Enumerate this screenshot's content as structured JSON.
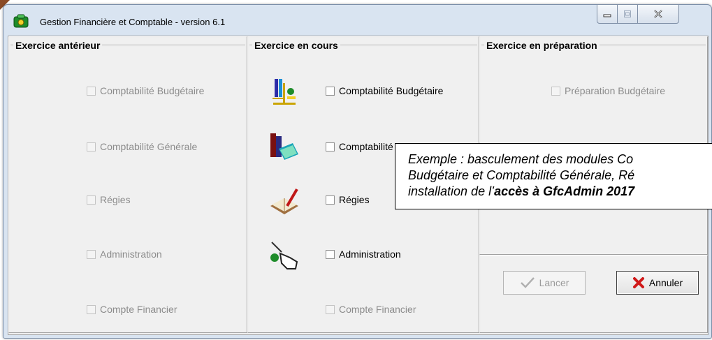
{
  "window": {
    "title": "Gestion Financière et Comptable - version 6.1",
    "controls": [
      "minimize-icon",
      "maximize-icon",
      "close-icon"
    ]
  },
  "panels": {
    "anterieur": {
      "title": "Exercice antérieur",
      "items": [
        {
          "label": "Comptabilité Budgétaire",
          "checked": false,
          "enabled": false
        },
        {
          "label": "Comptabilité Générale",
          "checked": false,
          "enabled": false
        },
        {
          "label": "Régies",
          "checked": false,
          "enabled": false
        },
        {
          "label": "Administration",
          "checked": false,
          "enabled": false
        },
        {
          "label": "Compte Financier",
          "checked": false,
          "enabled": false
        }
      ]
    },
    "en_cours": {
      "title": "Exercice en cours",
      "items": [
        {
          "label": "Comptabilité Budgétaire",
          "icon": "budget-scale-icon",
          "checked": false,
          "enabled": true
        },
        {
          "label": "Comptabilité Générale",
          "icon": "books-icon",
          "checked": false,
          "enabled": true
        },
        {
          "label": "Régies",
          "icon": "ledger-pen-icon",
          "checked": false,
          "enabled": true
        },
        {
          "label": "Administration",
          "icon": "hand-pointer-icon",
          "checked": false,
          "enabled": true
        },
        {
          "label": "Compte Financier",
          "checked": false,
          "enabled": false
        }
      ]
    },
    "preparation": {
      "title": "Exercice en préparation",
      "items": [
        {
          "label": "Préparation Budgétaire",
          "checked": false,
          "enabled": false
        }
      ]
    }
  },
  "buttons": {
    "launch": {
      "label": "Lancer",
      "icon": "checkmark-icon",
      "enabled": false
    },
    "cancel": {
      "label": "Annuler",
      "icon": "red-x-icon",
      "enabled": true
    }
  },
  "callout": {
    "line1": "Exemple : basculement des modules Co",
    "line2": "Budgétaire et Comptabilité Générale, Ré",
    "line3_prefix": "installation de l’",
    "line3_bold": "accès à GfcAdmin 2017"
  },
  "colors": {
    "accent_icon": "#1e8c2a",
    "cancel_x": "#d01818"
  }
}
